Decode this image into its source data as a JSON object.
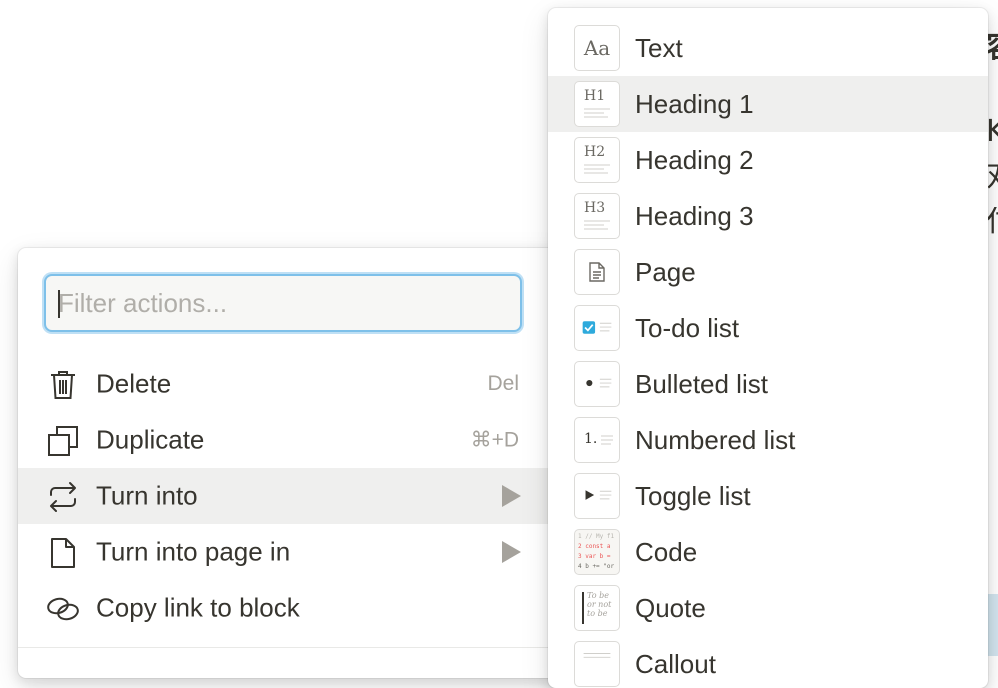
{
  "background": {
    "glyphs": [
      "容",
      "K",
      "对",
      "付"
    ]
  },
  "actions_menu": {
    "filter_placeholder": "Filter actions...",
    "items": [
      {
        "label": "Delete",
        "shortcut": "Del",
        "icon": "trash-icon"
      },
      {
        "label": "Duplicate",
        "shortcut": "⌘+D",
        "icon": "duplicate-icon"
      },
      {
        "label": "Turn into",
        "icon": "turn-into-icon",
        "has_submenu": true,
        "selected": true
      },
      {
        "label": "Turn into page in",
        "icon": "page-icon",
        "has_submenu": true
      },
      {
        "label": "Copy link to block",
        "icon": "link-icon"
      }
    ]
  },
  "turn_into_menu": {
    "items": [
      {
        "label": "Text",
        "icon": "text-icon",
        "icon_text": "Aa"
      },
      {
        "label": "Heading 1",
        "icon": "heading1-icon",
        "icon_text": "H1",
        "selected": true
      },
      {
        "label": "Heading 2",
        "icon": "heading2-icon",
        "icon_text": "H2"
      },
      {
        "label": "Heading 3",
        "icon": "heading3-icon",
        "icon_text": "H3"
      },
      {
        "label": "Page",
        "icon": "page-icon"
      },
      {
        "label": "To-do list",
        "icon": "todo-icon"
      },
      {
        "label": "Bulleted list",
        "icon": "bulleted-list-icon"
      },
      {
        "label": "Numbered list",
        "icon": "numbered-list-icon",
        "icon_text": "1."
      },
      {
        "label": "Toggle list",
        "icon": "toggle-list-icon"
      },
      {
        "label": "Code",
        "icon": "code-icon",
        "icon_text_lines": [
          "1 // My f1",
          "2 const a",
          "3 var b =",
          "4 b += \"or"
        ]
      },
      {
        "label": "Quote",
        "icon": "quote-icon",
        "icon_text_lines": [
          "To be",
          "or not",
          "to be"
        ]
      },
      {
        "label": "Callout",
        "icon": "callout-icon"
      }
    ]
  },
  "colors": {
    "text": "#37352f",
    "muted": "#a5a29c",
    "selected_bg": "#efefee",
    "focus_ring": "#7ec0e9",
    "checkbox": "#2eaadc"
  }
}
